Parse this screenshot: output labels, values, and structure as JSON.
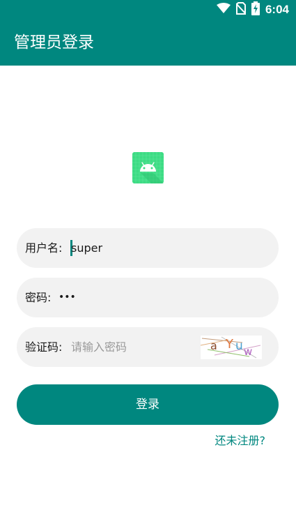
{
  "status_bar": {
    "time": "6:04",
    "icons": [
      "wifi-icon",
      "no-sim-icon",
      "battery-charging-icon"
    ]
  },
  "app_bar": {
    "title": "管理员登录"
  },
  "logo": {
    "icon": "android-icon"
  },
  "form": {
    "username_label": "用户名:",
    "username_value": "super",
    "password_label": "密码:",
    "password_value": "•••",
    "captcha_label": "验证码:",
    "captcha_placeholder": "请输入密码",
    "captcha_text": "aYuw"
  },
  "login_button": "登录",
  "register_link": "还未注册?",
  "colors": {
    "primary": "#00877f",
    "field_bg": "#f2f2f2",
    "logo_green": "#3ddc84"
  }
}
